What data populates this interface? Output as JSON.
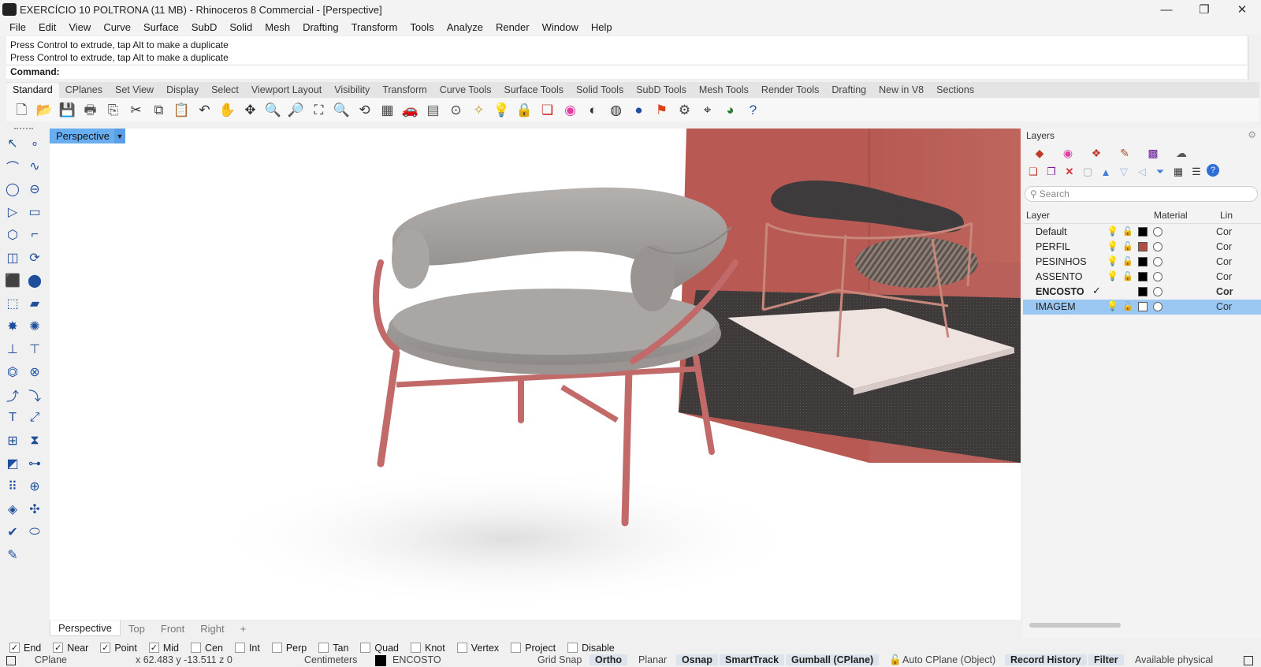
{
  "window": {
    "title": "EXERCÍCIO 10 POLTRONA (11 MB) - Rhinoceros 8 Commercial - [Perspective]",
    "minimize": "—",
    "restore": "❐",
    "close": "✕"
  },
  "menu": [
    "File",
    "Edit",
    "View",
    "Curve",
    "Surface",
    "SubD",
    "Solid",
    "Mesh",
    "Drafting",
    "Transform",
    "Tools",
    "Analyze",
    "Render",
    "Window",
    "Help"
  ],
  "command": {
    "history": [
      "Press Control to extrude, tap Alt to make a duplicate",
      "Press Control to extrude, tap Alt to make a duplicate"
    ],
    "prompt": "Command:"
  },
  "toolbar_tabs": [
    "Standard",
    "CPlanes",
    "Set View",
    "Display",
    "Select",
    "Viewport Layout",
    "Visibility",
    "Transform",
    "Curve Tools",
    "Surface Tools",
    "Solid Tools",
    "SubD Tools",
    "Mesh Tools",
    "Render Tools",
    "Drafting",
    "New in V8",
    "Sections"
  ],
  "toolbar_icons": [
    {
      "name": "new-icon",
      "glyph": "🗋"
    },
    {
      "name": "open-icon",
      "glyph": "📂"
    },
    {
      "name": "save-icon",
      "glyph": "💾"
    },
    {
      "name": "print-icon",
      "glyph": "🖶"
    },
    {
      "name": "import-icon",
      "glyph": "⎘"
    },
    {
      "name": "cut-icon",
      "glyph": "✂"
    },
    {
      "name": "copy-icon",
      "glyph": "⧉"
    },
    {
      "name": "paste-icon",
      "glyph": "📋"
    },
    {
      "name": "undo-icon",
      "glyph": "↶"
    },
    {
      "name": "pan-icon",
      "glyph": "✋"
    },
    {
      "name": "rotate-view-icon",
      "glyph": "✥"
    },
    {
      "name": "zoom-icon",
      "glyph": "🔍"
    },
    {
      "name": "zoom-window-icon",
      "glyph": "🔎"
    },
    {
      "name": "zoom-extents-icon",
      "glyph": "⛶"
    },
    {
      "name": "zoom-selected-icon",
      "glyph": "🔍"
    },
    {
      "name": "undo-view-icon",
      "glyph": "⟲"
    },
    {
      "name": "viewport-layout-icon",
      "glyph": "▦"
    },
    {
      "name": "car-icon",
      "glyph": "🚗"
    },
    {
      "name": "grid-icon",
      "glyph": "▤"
    },
    {
      "name": "osnap-icon",
      "glyph": "⊙"
    },
    {
      "name": "object-props-icon",
      "glyph": "✧"
    },
    {
      "name": "light-icon",
      "glyph": "💡"
    },
    {
      "name": "lock-icon",
      "glyph": "🔒"
    },
    {
      "name": "layer-icon",
      "glyph": "❏"
    },
    {
      "name": "color-wheel-icon",
      "glyph": "◉"
    },
    {
      "name": "shade-icon",
      "glyph": "◐"
    },
    {
      "name": "render-preview-icon",
      "glyph": "◍"
    },
    {
      "name": "render-sphere-icon",
      "glyph": "●"
    },
    {
      "name": "snapshot-icon",
      "glyph": "⚑"
    },
    {
      "name": "options-icon",
      "glyph": "⚙"
    },
    {
      "name": "dimension-icon",
      "glyph": "⌖"
    },
    {
      "name": "render-green-icon",
      "glyph": "◕"
    },
    {
      "name": "help-icon",
      "glyph": "?"
    }
  ],
  "left_tools": [
    {
      "name": "select-arrow-icon",
      "glyph": "↖"
    },
    {
      "name": "point-icon",
      "glyph": "∘"
    },
    {
      "name": "polyline-icon",
      "glyph": "⌒"
    },
    {
      "name": "curve-cv-icon",
      "glyph": "∿"
    },
    {
      "name": "circle-icon",
      "glyph": "◯"
    },
    {
      "name": "ellipse-icon",
      "glyph": "⊖"
    },
    {
      "name": "polygon-icon",
      "glyph": "▷"
    },
    {
      "name": "rectangle-icon",
      "glyph": "▭"
    },
    {
      "name": "offset-icon",
      "glyph": "⬡"
    },
    {
      "name": "fillet-icon",
      "glyph": "⌐"
    },
    {
      "name": "surface-corner-icon",
      "glyph": "◫"
    },
    {
      "name": "revolve-icon",
      "glyph": "⟳"
    },
    {
      "name": "box-icon",
      "glyph": "⬛"
    },
    {
      "name": "sphere-icon",
      "glyph": "⬤"
    },
    {
      "name": "extrude-icon",
      "glyph": "⬚"
    },
    {
      "name": "plane-icon",
      "glyph": "▰"
    },
    {
      "name": "boolean-icon",
      "glyph": "✸"
    },
    {
      "name": "explode-icon",
      "glyph": "✺"
    },
    {
      "name": "split-icon",
      "glyph": "⊥"
    },
    {
      "name": "trim-icon",
      "glyph": "⊤"
    },
    {
      "name": "union-icon",
      "glyph": "⏣"
    },
    {
      "name": "difference-icon",
      "glyph": "⊗"
    },
    {
      "name": "join-curve-icon",
      "glyph": "⤴"
    },
    {
      "name": "blend-icon",
      "glyph": "⤵"
    },
    {
      "name": "text-icon",
      "glyph": "T"
    },
    {
      "name": "dim-icon",
      "glyph": "⤢"
    },
    {
      "name": "array-icon",
      "glyph": "⊞"
    },
    {
      "name": "mirror-icon",
      "glyph": "⧗"
    },
    {
      "name": "solid-box-icon",
      "glyph": "◩"
    },
    {
      "name": "ruler-icon",
      "glyph": "⊶"
    },
    {
      "name": "grid-array-icon",
      "glyph": "⠿"
    },
    {
      "name": "gumball-icon",
      "glyph": "⊕"
    },
    {
      "name": "shell-icon",
      "glyph": "◈"
    },
    {
      "name": "move-icon",
      "glyph": "✣"
    },
    {
      "name": "check-icon",
      "glyph": "✔"
    },
    {
      "name": "cylinder-icon",
      "glyph": "⬭"
    },
    {
      "name": "paint-icon",
      "glyph": "✎"
    }
  ],
  "viewport": {
    "active_label": "Perspective",
    "tabs": [
      "Perspective",
      "Top",
      "Front",
      "Right",
      "+"
    ]
  },
  "layers": {
    "title": "Layers",
    "search_placeholder": "Search",
    "columns": {
      "layer": "Layer",
      "material": "Material",
      "linetype": "Lin"
    },
    "rows": [
      {
        "name": "Default",
        "color": "#000000",
        "current": false,
        "visible": true,
        "selected": false,
        "linetype": "Cor"
      },
      {
        "name": "PERFIL",
        "color": "#b14e42",
        "current": false,
        "visible": true,
        "selected": false,
        "linetype": "Cor"
      },
      {
        "name": "PESINHOS",
        "color": "#000000",
        "current": false,
        "visible": true,
        "selected": false,
        "linetype": "Cor"
      },
      {
        "name": "ASSENTO",
        "color": "#000000",
        "current": false,
        "visible": true,
        "selected": false,
        "linetype": "Cor"
      },
      {
        "name": "ENCOSTO",
        "color": "#000000",
        "current": true,
        "visible": true,
        "selected": false,
        "linetype": "Cor"
      },
      {
        "name": "IMAGEM",
        "color": "#ffffff",
        "current": false,
        "visible": true,
        "selected": true,
        "linetype": "Cor"
      }
    ],
    "current_mark": "✓"
  },
  "osnaps": [
    {
      "label": "End",
      "checked": true
    },
    {
      "label": "Near",
      "checked": true
    },
    {
      "label": "Point",
      "checked": true
    },
    {
      "label": "Mid",
      "checked": true
    },
    {
      "label": "Cen",
      "checked": false
    },
    {
      "label": "Int",
      "checked": false
    },
    {
      "label": "Perp",
      "checked": false
    },
    {
      "label": "Tan",
      "checked": false
    },
    {
      "label": "Quad",
      "checked": false
    },
    {
      "label": "Knot",
      "checked": false
    },
    {
      "label": "Vertex",
      "checked": false
    },
    {
      "label": "Project",
      "checked": false
    },
    {
      "label": "Disable",
      "checked": false
    }
  ],
  "status": {
    "cplane": "CPlane",
    "coords": "x 62.483  y -13.511  z 0",
    "units": "Centimeters",
    "current_layer": "ENCOSTO",
    "grid_snap": "Grid Snap",
    "ortho": "Ortho",
    "planar": "Planar",
    "osnap": "Osnap",
    "smarttrack": "SmartTrack",
    "gumball": "Gumball (CPlane)",
    "auto_cplane": "Auto CPlane (Object)",
    "record_history": "Record History",
    "filter": "Filter",
    "available": "Available physical"
  },
  "colors": {
    "viewport_tab": "#6aaef2",
    "selected_layer": "#9ac8f3",
    "chair_frame": "#c26a6a",
    "chair_fabric": "#a8a4a2",
    "wall": "#b8554e"
  }
}
